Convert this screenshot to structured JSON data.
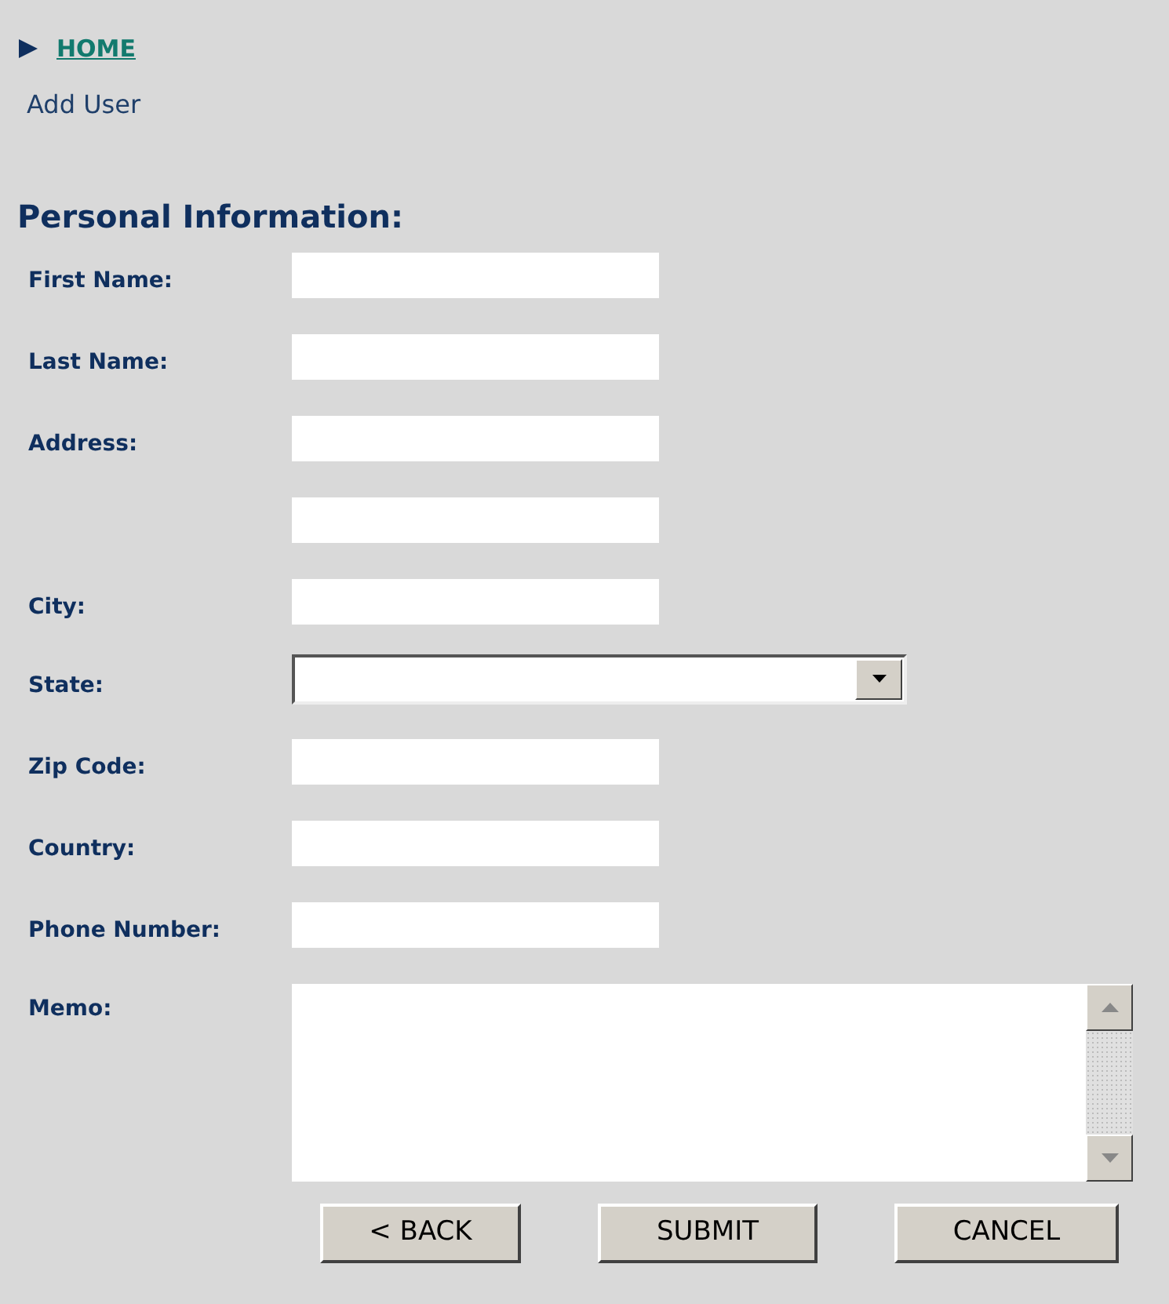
{
  "breadcrumb": {
    "link": "HOME",
    "page": "Add User"
  },
  "section": {
    "title": "Personal Information:"
  },
  "fields": [
    {
      "kind": "text",
      "label": "First Name:"
    },
    {
      "kind": "text",
      "label": "Last Name:"
    },
    {
      "kind": "text",
      "label": "Address:"
    },
    {
      "kind": "text"
    },
    {
      "kind": "text",
      "label": "City:"
    },
    {
      "kind": "select",
      "label": "State:"
    },
    {
      "kind": "text",
      "label": "Zip Code:"
    },
    {
      "kind": "text",
      "label": "Country:"
    },
    {
      "kind": "text",
      "label": "Phone Number:"
    },
    {
      "kind": "textarea",
      "label": "Memo:"
    }
  ],
  "buttons": [
    "< BACK",
    "SUBMIT",
    "CANCEL"
  ]
}
